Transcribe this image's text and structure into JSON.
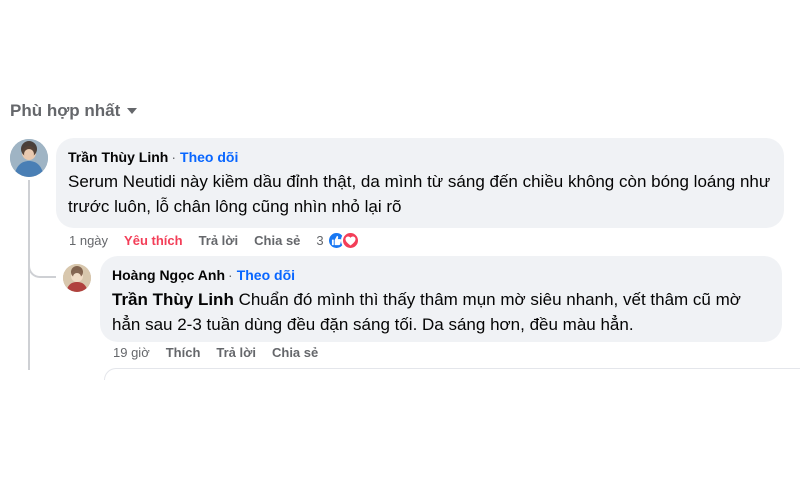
{
  "sort": {
    "label": "Phù hợp nhất"
  },
  "comments": [
    {
      "author": "Trần Thùy Linh",
      "follow": "Theo dõi",
      "text": "Serum Neutidi này kiềm dầu đỉnh thật, da mình từ sáng đến chiều không còn bóng loáng như trước luôn, lỗ chân lông cũng nhìn nhỏ lại rõ",
      "time": "1 ngày",
      "like_label": "Yêu thích",
      "reply_label": "Trả lời",
      "share_label": "Chia sẻ",
      "reaction_count": "3",
      "reaction_icons": [
        "like-icon",
        "love-icon"
      ],
      "colors": {
        "like_active": "#f33e58"
      }
    }
  ],
  "replies": [
    {
      "author": "Hoàng Ngọc Anh",
      "follow": "Theo dõi",
      "mention": "Trần Thùy Linh",
      "text": " Chuẩn đó mình thì thấy thâm mụn mờ siêu nhanh, vết thâm cũ mờ hẳn sau 2-3 tuần dùng đều đặn sáng tối. Da sáng hơn, đều màu hẳn.",
      "time": "19 giờ",
      "like_label": "Thích",
      "reply_label": "Trả lời",
      "share_label": "Chia sẻ"
    }
  ],
  "colors": {
    "link": "#0866ff",
    "secondary_text": "#65676b",
    "bubble": "#f0f2f5"
  }
}
